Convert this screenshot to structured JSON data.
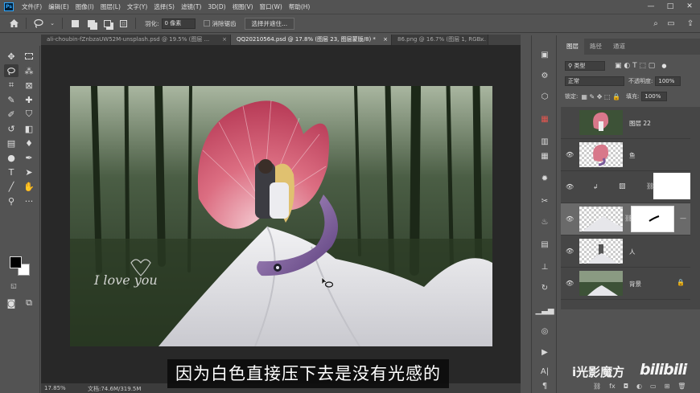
{
  "app": {
    "logo": "Ps",
    "menu": [
      "文件(F)",
      "编辑(E)",
      "图像(I)",
      "图层(L)",
      "文字(Y)",
      "选择(S)",
      "滤镜(T)",
      "3D(D)",
      "视图(V)",
      "窗口(W)",
      "帮助(H)"
    ],
    "window_controls": [
      "—",
      "□",
      "✕"
    ]
  },
  "options": {
    "feather_label": "羽化:",
    "feather_value": "0 像素",
    "antialias_label": "消除锯齿",
    "select_mask_button": "选择并遮住..."
  },
  "tabs": [
    {
      "label": "ali-choubin-fZnbzaUW52M-unsplash.psd @ 19.5% (图层 ...",
      "close": "×",
      "active": false
    },
    {
      "label": "QQ20210564.psd @ 17.8% (图层 23, 图层蒙版/8) *",
      "close": "×",
      "active": true
    },
    {
      "label": "86.png @ 16.7% (图层 1, RGB...",
      "close": "×",
      "active": false
    }
  ],
  "canvas": {
    "artwork_text": "I love you"
  },
  "status": {
    "zoom": "17.85%",
    "doc": "文档:74.6M/319.5M"
  },
  "layers_panel": {
    "tabs": [
      "图层",
      "路径",
      "通道"
    ],
    "filter_label": "类型",
    "blend_mode": "正常",
    "opacity_label": "不透明度:",
    "opacity_value": "100%",
    "lock_label": "锁定:",
    "fill_label": "填充:",
    "fill_value": "100%",
    "layers": [
      {
        "name": "图层 22",
        "visible": false
      },
      {
        "name": "鱼",
        "visible": true
      },
      {
        "name": "",
        "visible": true
      },
      {
        "name": "",
        "visible": true,
        "selected": true
      },
      {
        "name": "人",
        "visible": true
      },
      {
        "name": "背景",
        "visible": true,
        "locked": true
      }
    ],
    "bottom_icons": [
      "link-icon",
      "fx-icon",
      "mask-icon",
      "adjustment-icon",
      "folder-icon",
      "new-layer-icon",
      "trash-icon"
    ]
  },
  "overlay": {
    "caption": "因为白色直接压下去是没有光感的",
    "watermark_left": "i光影魔方",
    "watermark_right": "bilibili"
  }
}
